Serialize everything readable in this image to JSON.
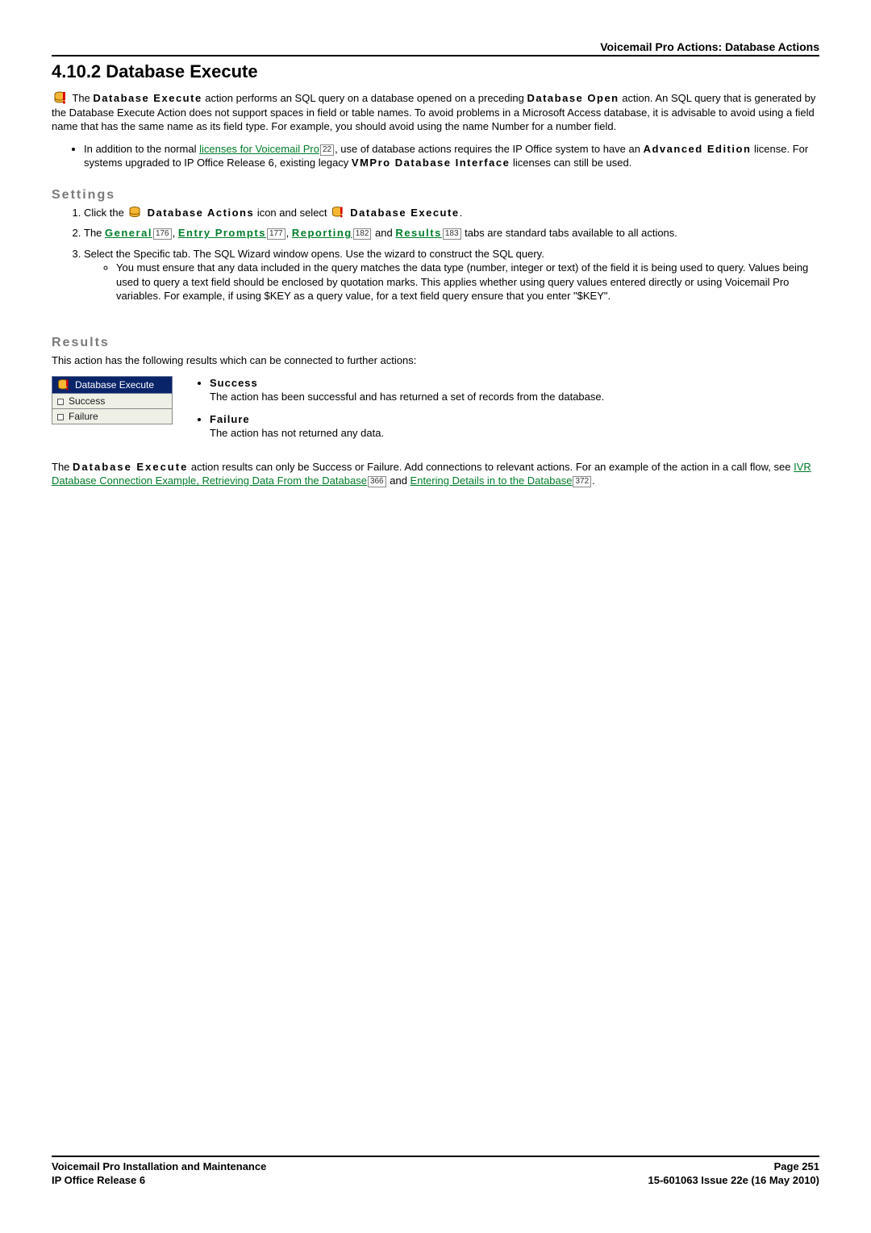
{
  "header": {
    "breadcrumb": "Voicemail Pro Actions: Database Actions"
  },
  "title": "4.10.2 Database Execute",
  "intro": {
    "p1_a": " The ",
    "p1_b": "Database Execute",
    "p1_c": " action performs an SQL query on a database opened on a preceding ",
    "p1_d": "Database Open",
    "p1_e": " action. An SQL query that is generated by the Database Execute Action does not support spaces in field or table names. To avoid problems in a Microsoft Access database, it is advisable to avoid using a field name that has the same name as its field type. For example, you should avoid using the name Number for a number field.",
    "bullet_a": "In addition to the normal ",
    "bullet_link": "licenses for Voicemail Pro",
    "bullet_ref": "22",
    "bullet_b": ", use of database actions requires the IP Office system to have an ",
    "bullet_c": "Advanced Edition",
    "bullet_d": " license. For systems upgraded to IP Office Release 6, existing legacy ",
    "bullet_e": "VMPro Database Interface",
    "bullet_f": " licenses can still be used."
  },
  "settings": {
    "heading": "Settings",
    "s1_a": "Click the ",
    "s1_b": " Database Actions",
    "s1_c": " icon and select ",
    "s1_d": " Database Execute",
    "s1_e": ".",
    "s2_a": "The ",
    "s2_general": "General",
    "s2_general_ref": "176",
    "s2_sep1": ", ",
    "s2_entry": "Entry Prompts",
    "s2_entry_ref": "177",
    "s2_sep2": ", ",
    "s2_reporting": "Reporting",
    "s2_reporting_ref": "182",
    "s2_and": " and ",
    "s2_results": "Results",
    "s2_results_ref": "183",
    "s2_b": " tabs are standard tabs available to all actions.",
    "s3": "Select the Specific tab. The SQL Wizard window opens. Use the wizard to construct the SQL query.",
    "s3_sub": "You must ensure that any data included in the query matches the data type (number, integer or text) of the field it is being used to query. Values being used to query a text field should be enclosed by quotation marks. This applies whether using query values entered directly or using Voicemail Pro variables. For example, if using $KEY as a query value, for a text field query ensure that you enter \"$KEY\"."
  },
  "results": {
    "heading": "Results",
    "intro": "This action has the following results which can be connected to further actions:",
    "fig_title": "Database Execute",
    "fig_pin1": "Success",
    "fig_pin2": "Failure",
    "succ_term": "Success",
    "succ_body": "The action has been successful and has returned a set of records from the database.",
    "fail_term": "Failure",
    "fail_body": "The action has not returned any data.",
    "para_a": "The ",
    "para_b": "Database Execute",
    "para_c": " action results can only be Success or Failure. Add connections to relevant actions. For an example of the action in a call flow, see ",
    "link1": "IVR Database Connection Example, Retrieving Data From the Database",
    "ref1": "366",
    "para_and": " and ",
    "link2": "Entering Details in to the Database",
    "ref2": "372",
    "para_end": "."
  },
  "footer": {
    "left1": "Voicemail Pro Installation and Maintenance",
    "left2": "IP Office Release 6",
    "right1": "Page 251",
    "right2": "15-601063 Issue 22e (16 May 2010)"
  }
}
